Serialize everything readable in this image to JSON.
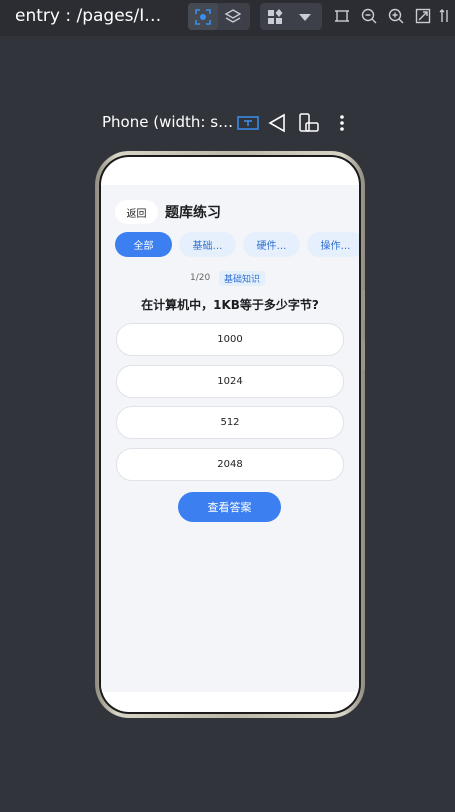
{
  "toolbar": {
    "entry_title": "entry : /pages/I…"
  },
  "preview": {
    "device_label": "Phone (width: s…"
  },
  "app": {
    "back_label": "返回",
    "title": "题库练习",
    "categories": [
      "全部",
      "基础…",
      "硬件…",
      "操作…"
    ],
    "active_category": "全部",
    "progress": "1/20",
    "question_tag": "基础知识",
    "question": "在计算机中，1KB等于多少字节?",
    "options": [
      "1000",
      "1024",
      "512",
      "2048"
    ],
    "answer_button": "查看答案"
  },
  "colors": {
    "accent": "#3b7ff0",
    "chip_bg": "#e6f0fc",
    "page_bg": "#f3f5f9",
    "ide_bg": "#31343b"
  }
}
